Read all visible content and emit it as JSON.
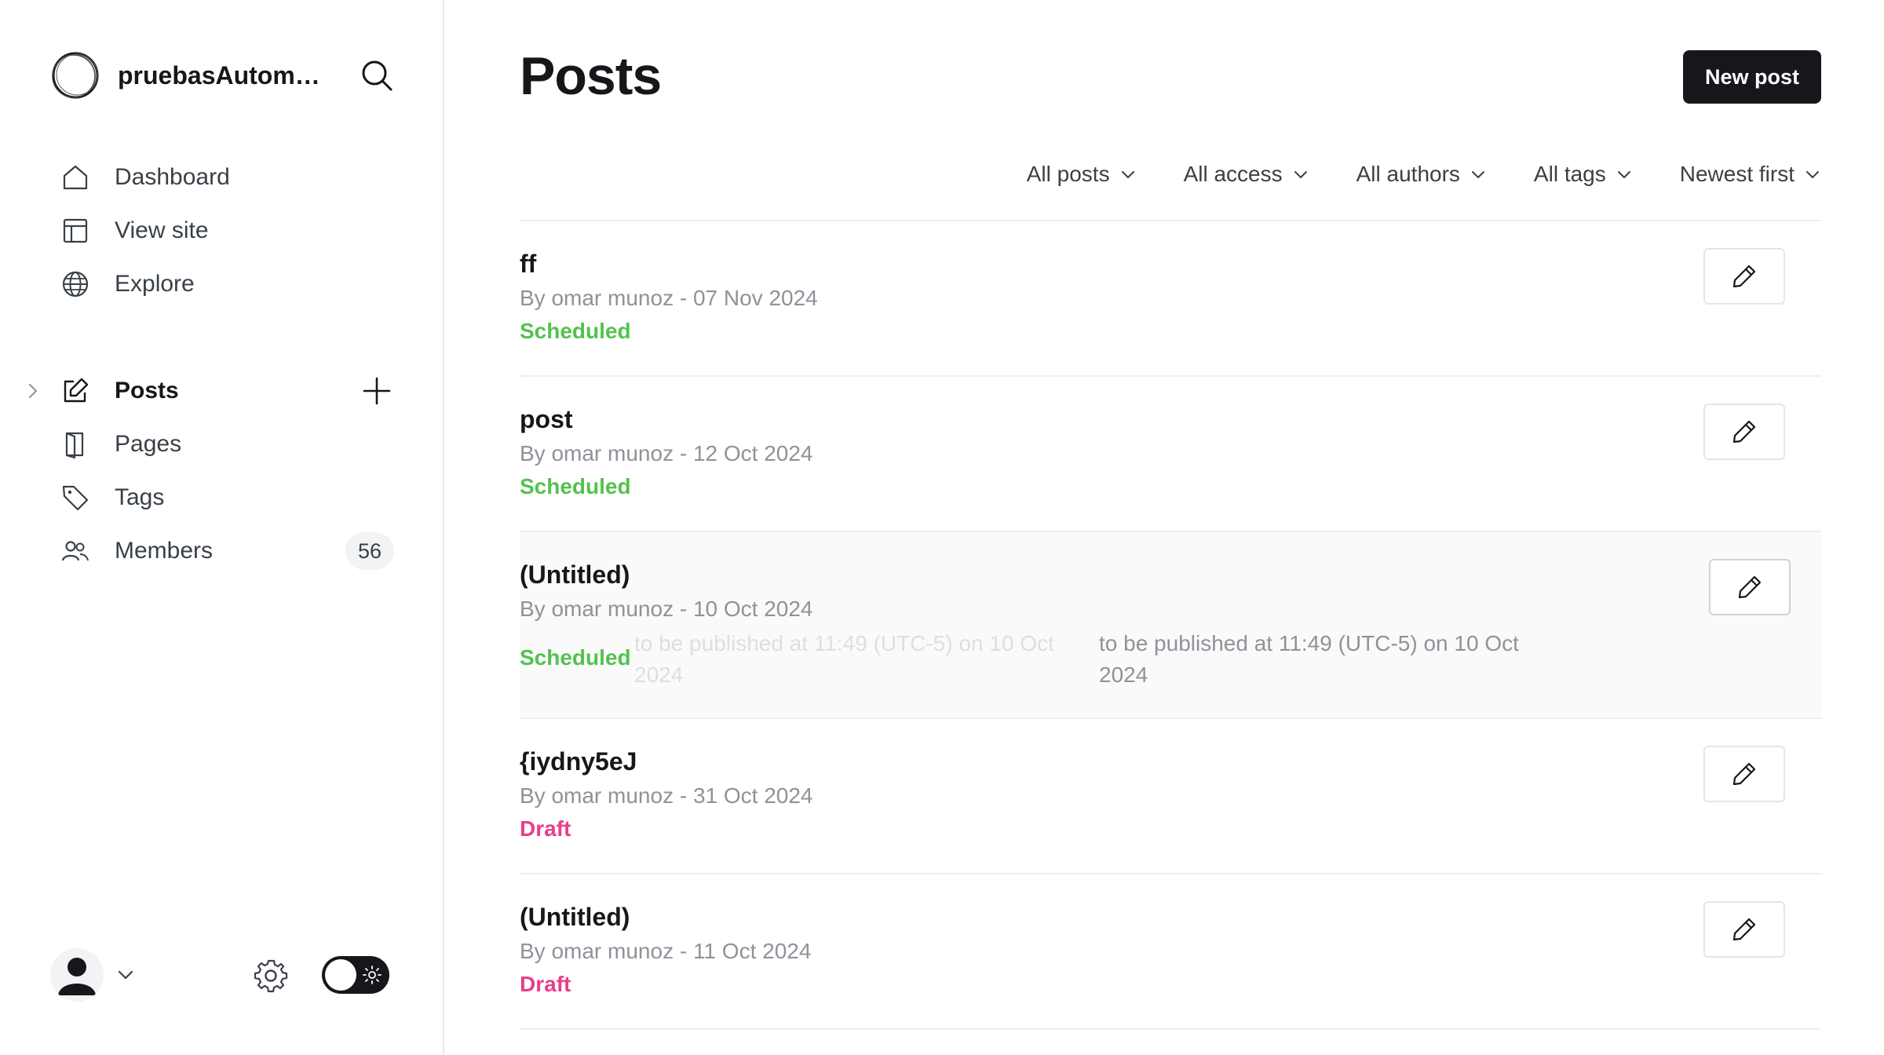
{
  "sidebar": {
    "site_name": "pruebasAutoma...",
    "nav_top": [
      {
        "label": "Dashboard",
        "icon": "home-icon"
      },
      {
        "label": "View site",
        "icon": "layout-icon"
      },
      {
        "label": "Explore",
        "icon": "globe-icon"
      }
    ],
    "nav_content": [
      {
        "label": "Posts",
        "icon": "pencil-square-icon"
      },
      {
        "label": "Pages",
        "icon": "page-icon"
      },
      {
        "label": "Tags",
        "icon": "tag-icon"
      },
      {
        "label": "Members",
        "icon": "members-icon",
        "count": "56"
      }
    ]
  },
  "main": {
    "title": "Posts",
    "new_post_label": "New post",
    "filters": {
      "type": "All posts",
      "access": "All access",
      "authors": "All authors",
      "tags": "All tags",
      "order": "Newest first"
    },
    "posts": [
      {
        "title": "ff",
        "meta": "By omar munoz - 07 Nov 2024",
        "status": "Scheduled"
      },
      {
        "title": "post",
        "meta": "By omar munoz - 12 Oct 2024",
        "status": "Scheduled"
      },
      {
        "title": "(Untitled)",
        "meta": "By omar munoz - 10 Oct 2024",
        "status": "Scheduled",
        "tooltip": "to be published at 11:49 (UTC-5) on 10 Oct 2024"
      },
      {
        "title": "{iydny5eJ",
        "meta": "By omar munoz - 31 Oct 2024",
        "status": "Draft"
      },
      {
        "title": "(Untitled)",
        "meta": "By omar munoz - 11 Oct 2024",
        "status": "Draft"
      }
    ]
  },
  "colors": {
    "accent": "#15171a",
    "scheduled": "#54c24e",
    "draft": "#e83e8c",
    "muted_text": "#8e9399",
    "border": "#eceef0"
  }
}
